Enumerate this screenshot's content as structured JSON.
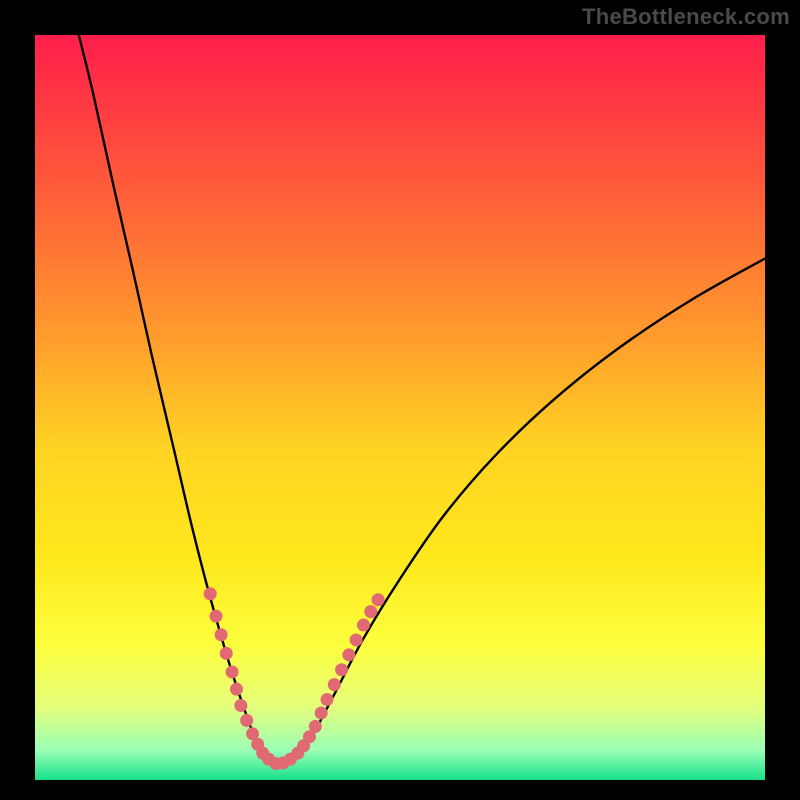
{
  "watermark": "TheBottleneck.com",
  "chart_data": {
    "type": "line",
    "title": "",
    "xlabel": "",
    "ylabel": "",
    "xlim": [
      0,
      100
    ],
    "ylim": [
      0,
      100
    ],
    "grid": false,
    "legend": false,
    "axes_visible": false,
    "background_gradient": {
      "stops": [
        {
          "offset": 0.0,
          "color": "#ff1e4a"
        },
        {
          "offset": 0.2,
          "color": "#ff5a3a"
        },
        {
          "offset": 0.4,
          "color": "#ff9a2d"
        },
        {
          "offset": 0.55,
          "color": "#ffd223"
        },
        {
          "offset": 0.7,
          "color": "#ffe81c"
        },
        {
          "offset": 0.82,
          "color": "#fcff3e"
        },
        {
          "offset": 0.9,
          "color": "#e6ff7a"
        },
        {
          "offset": 0.96,
          "color": "#9bffb5"
        },
        {
          "offset": 1.0,
          "color": "#18e08a"
        }
      ]
    },
    "curve": {
      "description": "Bottleneck curve (V-shaped), minimum at the optimal pairing, rising steeply on both sides.",
      "min_x": 33,
      "min_y": 2,
      "points": [
        {
          "x": 6.0,
          "y": 100.0
        },
        {
          "x": 8.0,
          "y": 92.0
        },
        {
          "x": 10.7,
          "y": 80.0
        },
        {
          "x": 13.5,
          "y": 68.0
        },
        {
          "x": 16.0,
          "y": 57.0
        },
        {
          "x": 19.0,
          "y": 44.5
        },
        {
          "x": 21.5,
          "y": 34.0
        },
        {
          "x": 24.0,
          "y": 24.5
        },
        {
          "x": 26.5,
          "y": 16.0
        },
        {
          "x": 28.5,
          "y": 10.0
        },
        {
          "x": 30.0,
          "y": 6.0
        },
        {
          "x": 31.5,
          "y": 3.5
        },
        {
          "x": 33.0,
          "y": 2.0
        },
        {
          "x": 34.5,
          "y": 2.2
        },
        {
          "x": 36.0,
          "y": 3.2
        },
        {
          "x": 38.0,
          "y": 6.0
        },
        {
          "x": 41.0,
          "y": 11.5
        },
        {
          "x": 45.0,
          "y": 19.0
        },
        {
          "x": 50.0,
          "y": 27.0
        },
        {
          "x": 56.0,
          "y": 35.5
        },
        {
          "x": 63.0,
          "y": 43.5
        },
        {
          "x": 71.0,
          "y": 51.0
        },
        {
          "x": 80.0,
          "y": 58.0
        },
        {
          "x": 90.0,
          "y": 64.5
        },
        {
          "x": 100.0,
          "y": 70.0
        }
      ]
    },
    "highlight_dots": {
      "color": "#e06973",
      "radius": 6.5,
      "y_range_approx": [
        2,
        25
      ],
      "points": [
        {
          "x": 24.0,
          "y": 25.0
        },
        {
          "x": 24.8,
          "y": 22.0
        },
        {
          "x": 25.5,
          "y": 19.5
        },
        {
          "x": 26.2,
          "y": 17.0
        },
        {
          "x": 27.0,
          "y": 14.5
        },
        {
          "x": 27.6,
          "y": 12.2
        },
        {
          "x": 28.2,
          "y": 10.0
        },
        {
          "x": 29.0,
          "y": 8.0
        },
        {
          "x": 29.8,
          "y": 6.2
        },
        {
          "x": 30.5,
          "y": 4.8
        },
        {
          "x": 31.2,
          "y": 3.6
        },
        {
          "x": 32.0,
          "y": 2.8
        },
        {
          "x": 33.0,
          "y": 2.2
        },
        {
          "x": 34.0,
          "y": 2.3
        },
        {
          "x": 35.0,
          "y": 2.8
        },
        {
          "x": 36.0,
          "y": 3.6
        },
        {
          "x": 36.8,
          "y": 4.6
        },
        {
          "x": 37.6,
          "y": 5.8
        },
        {
          "x": 38.4,
          "y": 7.2
        },
        {
          "x": 39.2,
          "y": 9.0
        },
        {
          "x": 40.0,
          "y": 10.8
        },
        {
          "x": 41.0,
          "y": 12.8
        },
        {
          "x": 42.0,
          "y": 14.8
        },
        {
          "x": 43.0,
          "y": 16.8
        },
        {
          "x": 44.0,
          "y": 18.8
        },
        {
          "x": 45.0,
          "y": 20.8
        },
        {
          "x": 46.0,
          "y": 22.6
        },
        {
          "x": 47.0,
          "y": 24.2
        }
      ]
    }
  }
}
